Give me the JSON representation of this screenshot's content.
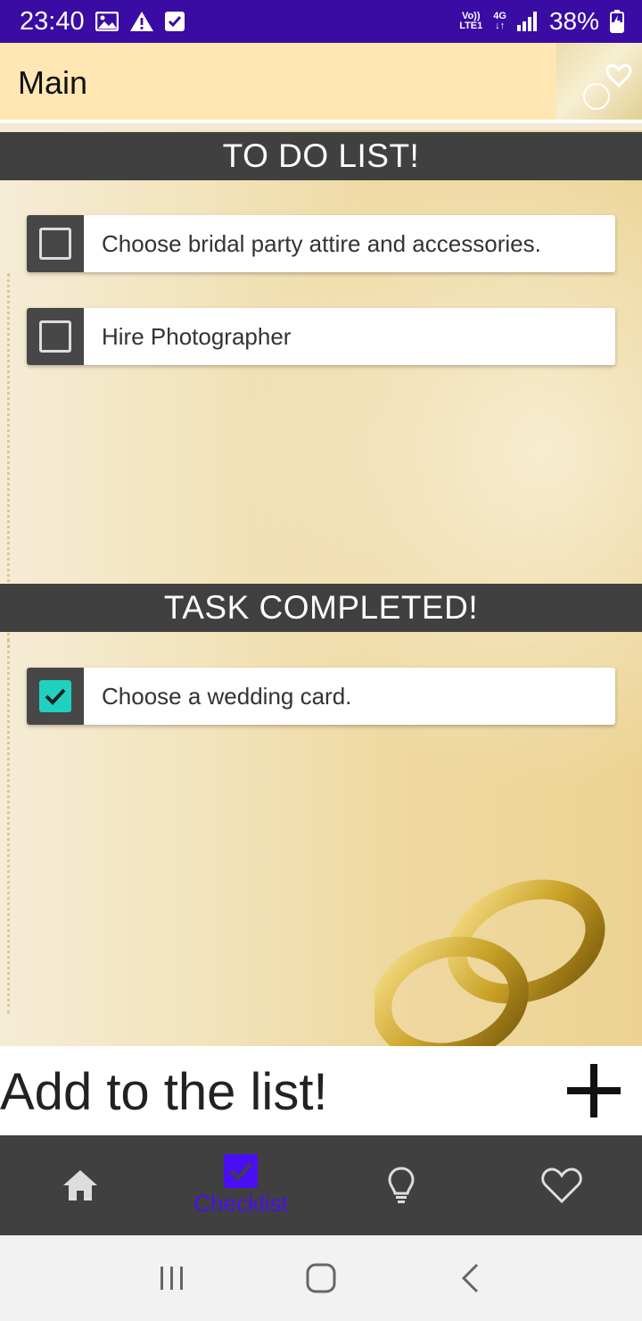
{
  "status_bar": {
    "time": "23:40",
    "network_top": "Vo))",
    "network_bottom": "LTE1",
    "net_type": "4G",
    "battery": "38%",
    "icons": [
      "image-icon",
      "warning-icon",
      "check-box-icon",
      "signal-icon",
      "battery-charging-icon"
    ]
  },
  "app_bar": {
    "title": "Main"
  },
  "todo": {
    "header": "TO DO LIST!",
    "items": [
      {
        "label": "Choose bridal party attire and accessories.",
        "checked": false
      },
      {
        "label": "Hire Photographer",
        "checked": false
      }
    ]
  },
  "completed": {
    "header": "TASK COMPLETED!",
    "items": [
      {
        "label": "Choose a wedding card.",
        "checked": true
      }
    ]
  },
  "add_bar": {
    "placeholder": "Add to the list!"
  },
  "bottom_nav": {
    "items": [
      {
        "icon": "home-icon",
        "label": ""
      },
      {
        "icon": "checklist-icon",
        "label": "Checklist",
        "active": true
      },
      {
        "icon": "lightbulb-icon",
        "label": ""
      },
      {
        "icon": "heart-icon",
        "label": ""
      }
    ]
  },
  "colors": {
    "status_bar": "#3a0ca3",
    "app_bar": "#ffe6b3",
    "section_header": "#404040",
    "check_teal": "#1fd1be",
    "nav_active": "#4a0ef2"
  }
}
